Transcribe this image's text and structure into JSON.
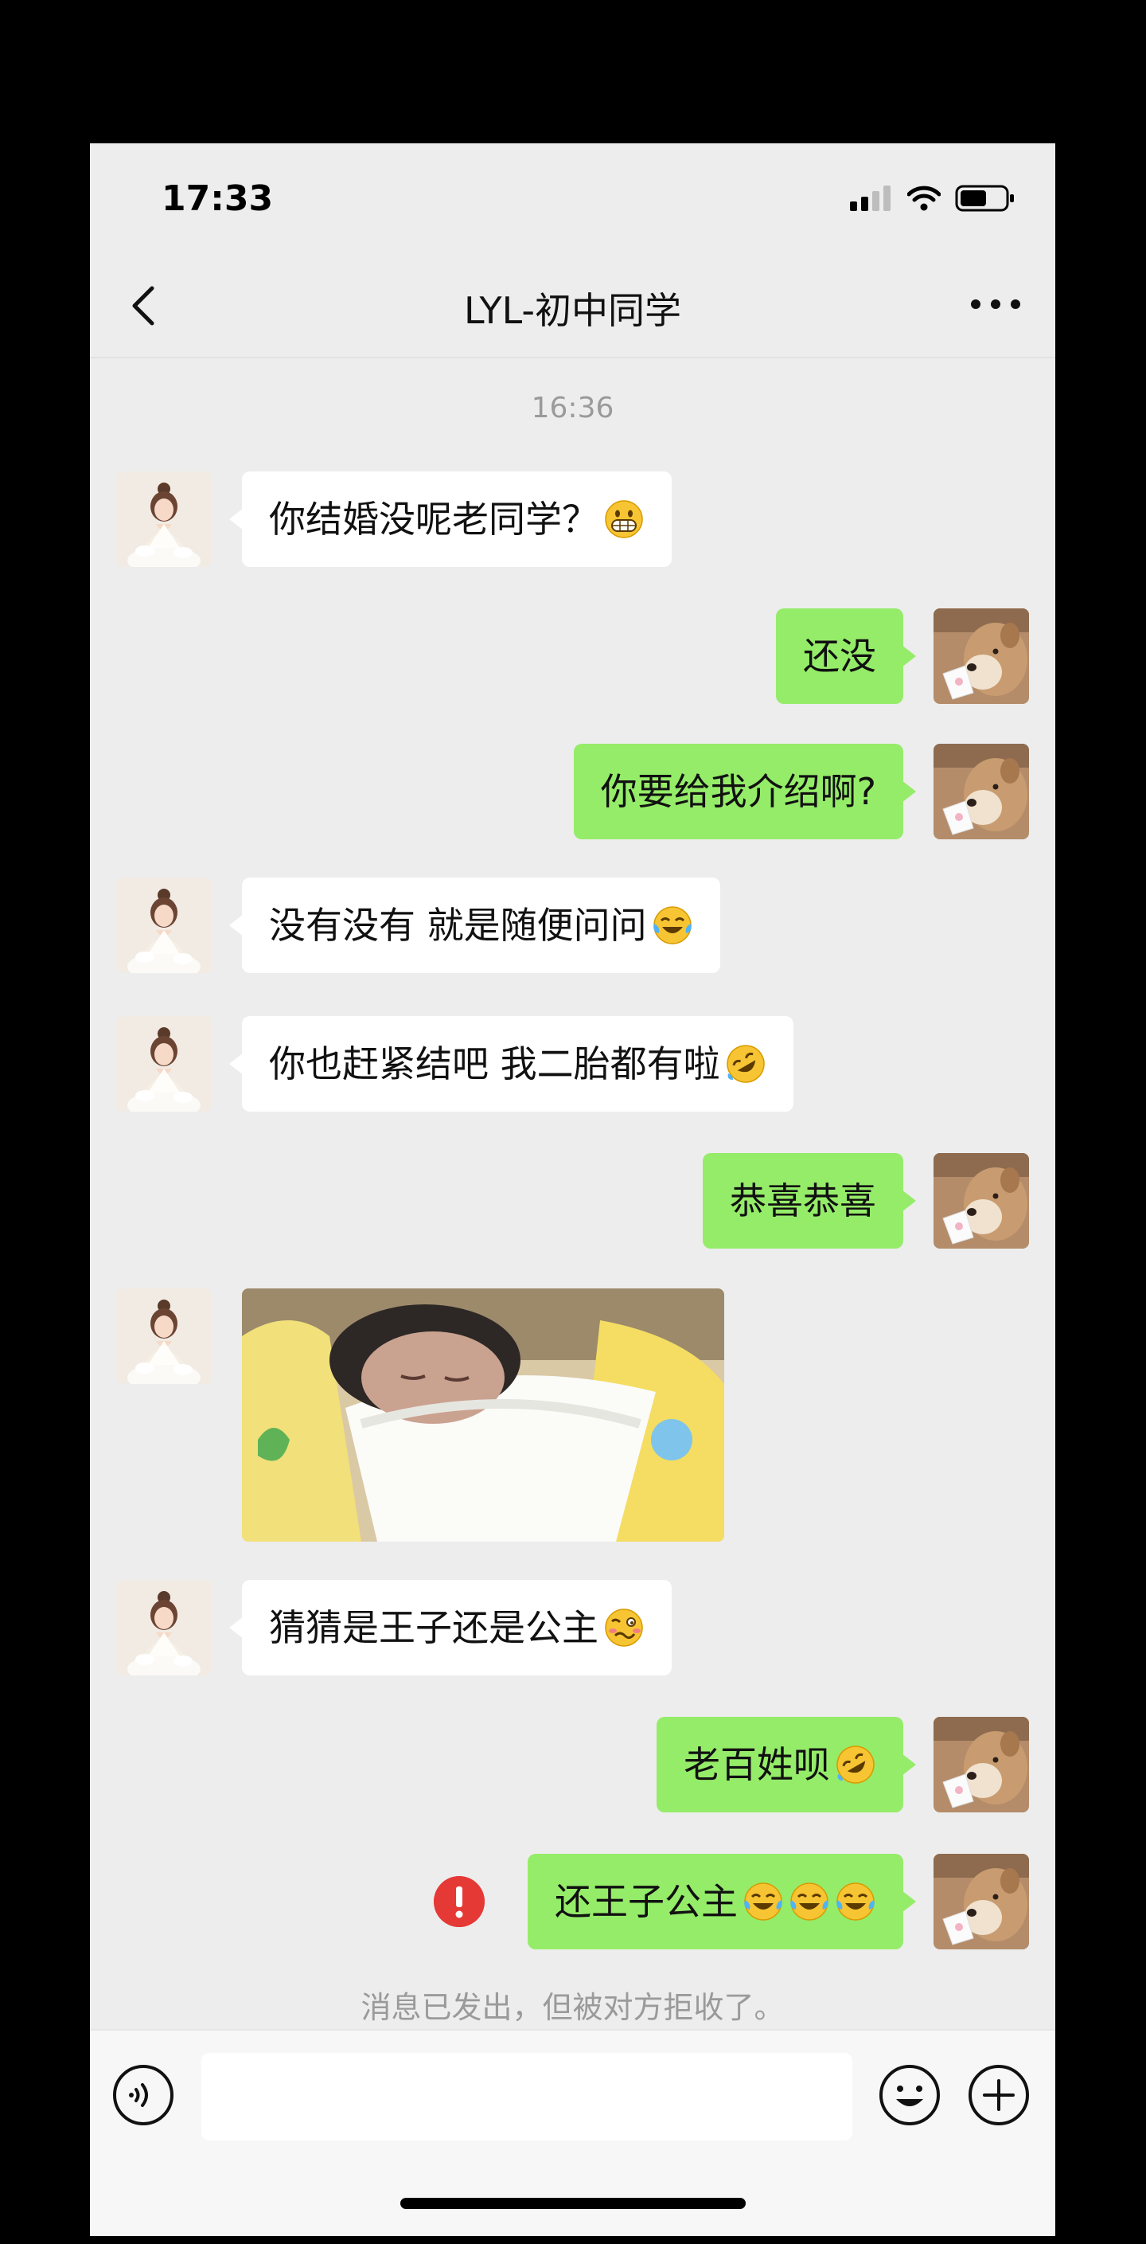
{
  "status_bar": {
    "time": "17:33"
  },
  "header": {
    "title": "LYL-初中同学"
  },
  "timestamp": "16:36",
  "messages": {
    "m1": {
      "text": "你结婚没呢老同学？"
    },
    "m2": {
      "text": "还没"
    },
    "m3": {
      "text": "你要给我介绍啊?"
    },
    "m4": {
      "text": "没有没有 就是随便问问"
    },
    "m5": {
      "text": "你也赶紧结吧 我二胎都有啦"
    },
    "m6": {
      "text": "恭喜恭喜"
    },
    "m8": {
      "text": "猜猜是王子还是公主"
    },
    "m9": {
      "text": "老百姓呗"
    },
    "m10": {
      "text": "还王子公主"
    }
  },
  "system_notice": "消息已发出，但被对方拒收了。",
  "icons": {
    "emoji_grin": "grinning-face-icon",
    "emoji_laugh_tears": "face-with-tears-of-joy-icon",
    "emoji_rofl": "rolling-on-floor-laughing-icon",
    "emoji_woozy": "woozy-face-icon",
    "send_failed": "exclamation-icon"
  },
  "colors": {
    "outgoing_bubble": "#95ec69",
    "incoming_bubble": "#ffffff",
    "background": "#ededed",
    "error": "#e53935"
  }
}
